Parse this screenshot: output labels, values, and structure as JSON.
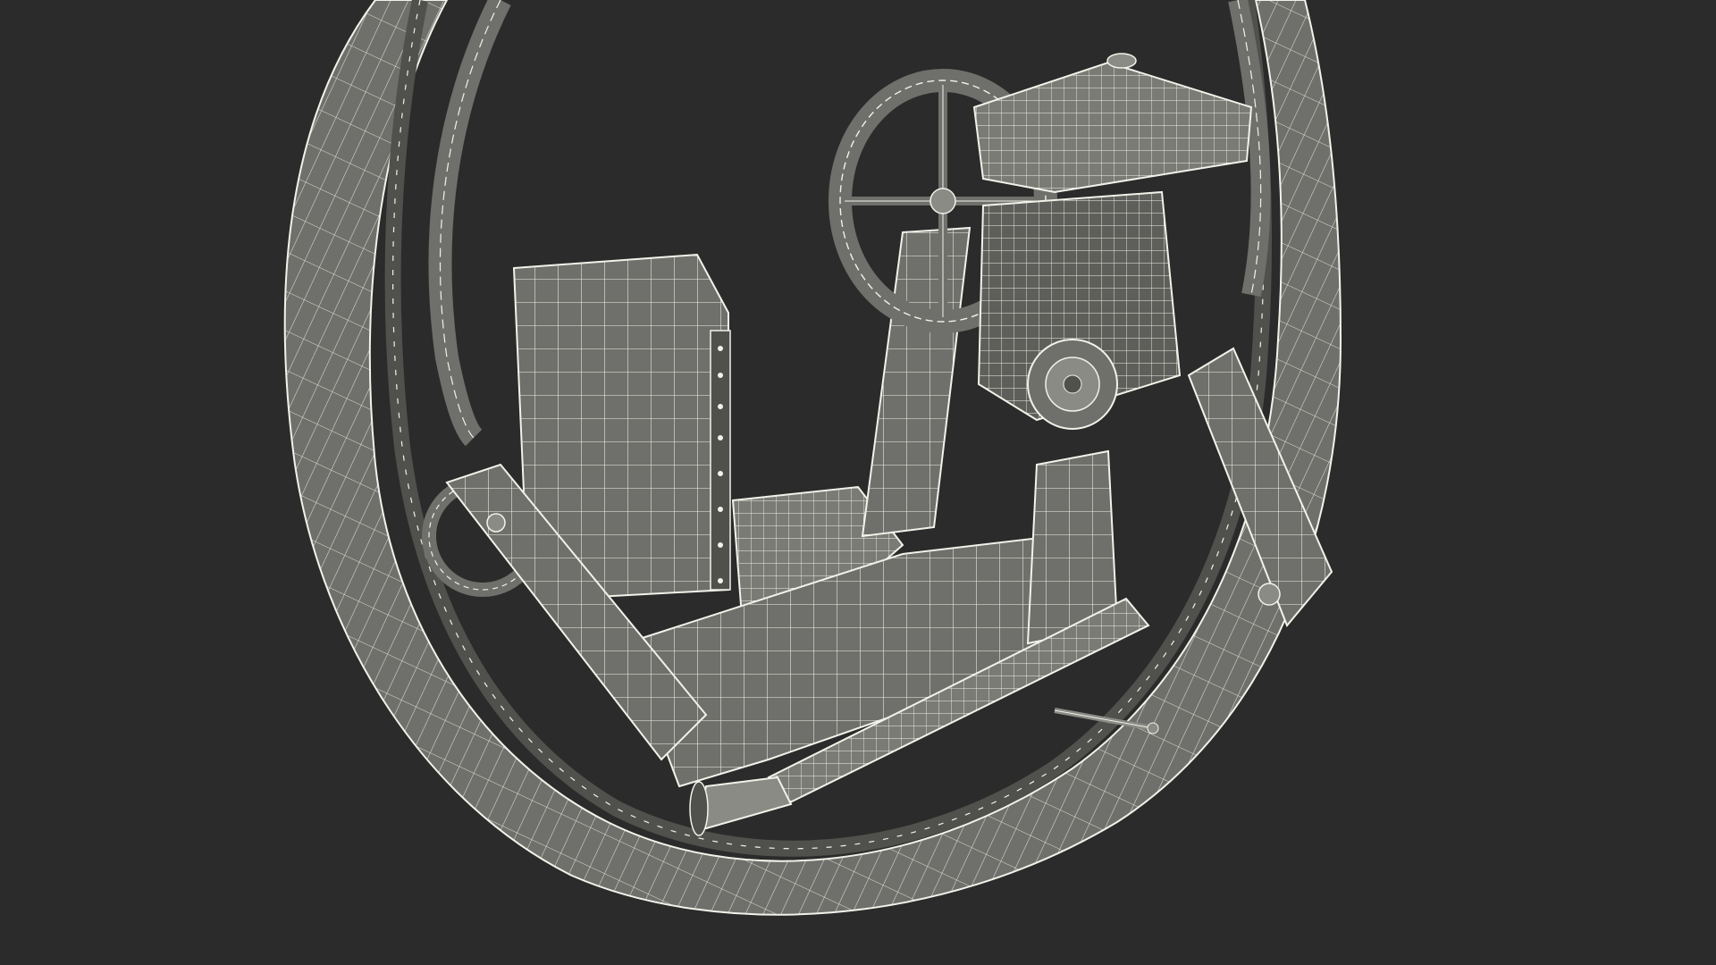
{
  "viewport": {
    "background": "#2b2b2b",
    "model": {
      "subject": "monowheel-vehicle-wireframe",
      "shade_fill": "#6f706b",
      "shade_light": "#8a8b85",
      "shade_dark": "#50514d",
      "wire_color": "#f2f2ea"
    }
  }
}
